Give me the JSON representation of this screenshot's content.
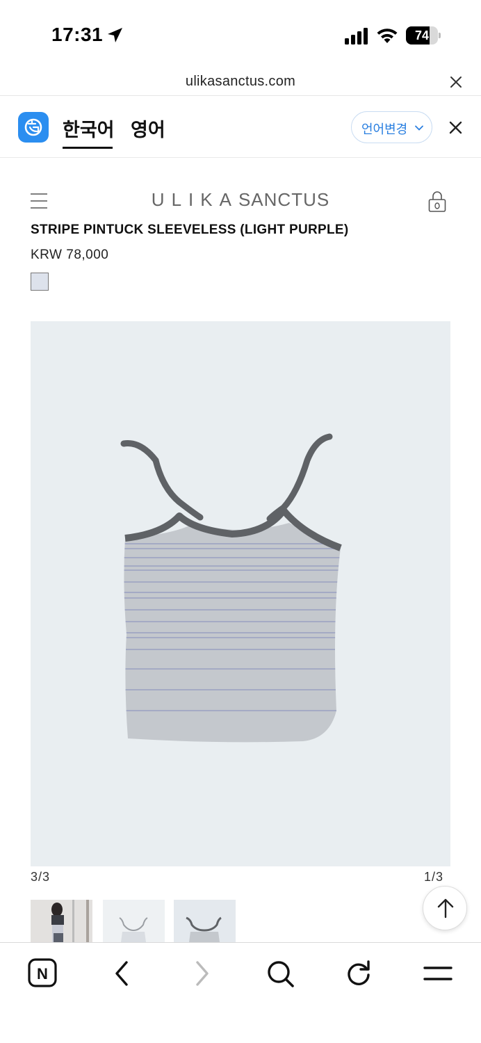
{
  "status_bar": {
    "time": "17:31",
    "battery_level": "74",
    "battery_fraction": 0.74
  },
  "url_bar": {
    "url": "ulikasanctus.com"
  },
  "translate_bar": {
    "tabs": [
      "한국어",
      "영어"
    ],
    "active_tab": "한국어",
    "language_change_label": "언어변경",
    "accent_color": "#2b8ef0"
  },
  "site_header": {
    "logo_spaced": "ULIKA",
    "logo_rest": "SANCTUS",
    "icons": [
      "menu-icon",
      "cart-icon"
    ]
  },
  "product": {
    "title": "STRIPE PINTUCK SLEEVELESS (LIGHT PURPLE)",
    "price": "KRW 78,000",
    "swatch_color": "#dde2ec"
  },
  "gallery": {
    "counter_left": "3/3",
    "counter_right": "1/3"
  },
  "toolbar": {
    "home_letter": "N",
    "icons": [
      "home-icon",
      "back-icon",
      "forward-icon",
      "search-icon",
      "reload-icon",
      "menu-icon"
    ]
  }
}
